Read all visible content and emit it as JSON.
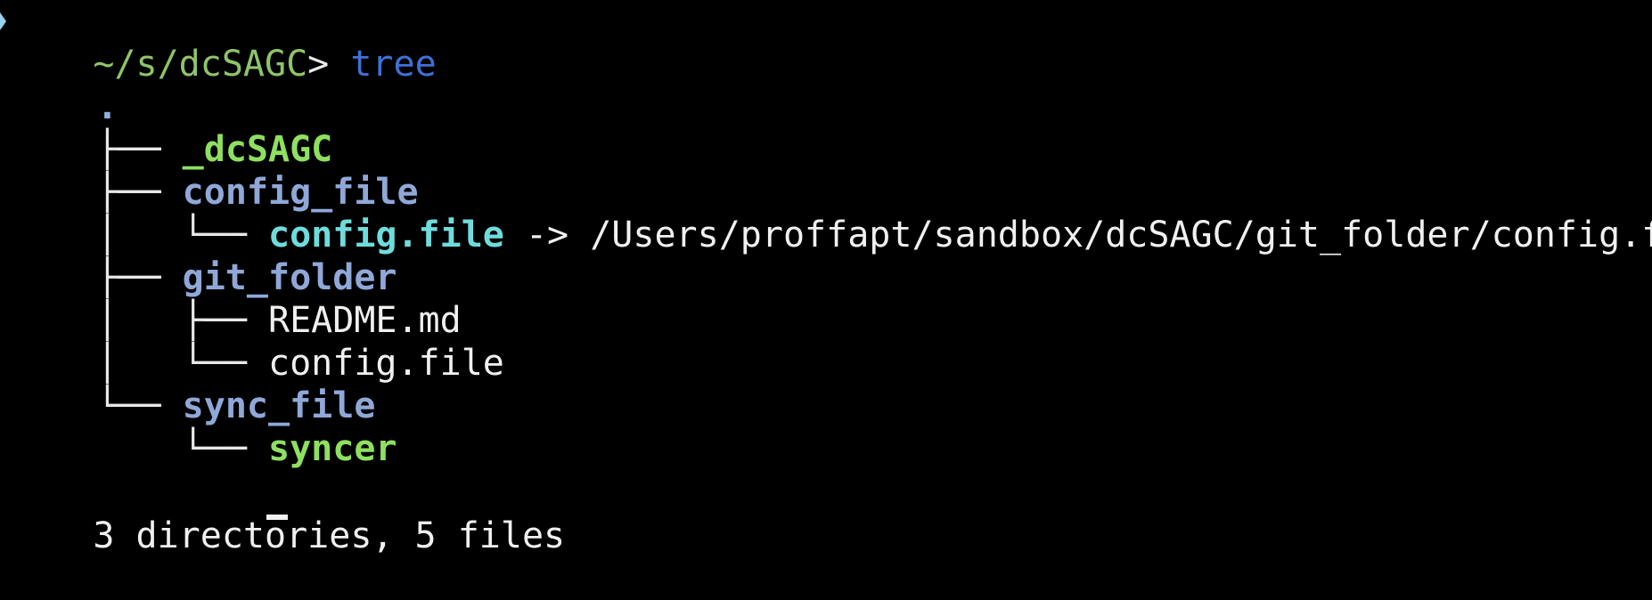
{
  "prompt": {
    "path": "~/s/dcSAGC",
    "symbol": ">",
    "command": "tree"
  },
  "tree": {
    "root": ".",
    "entries": [
      {
        "prefix": "├── ",
        "name": "_dcSAGC",
        "kind": "executable"
      },
      {
        "prefix": "├── ",
        "name": "config_file",
        "kind": "directory"
      },
      {
        "prefix": "│   └── ",
        "name": "config.file",
        "kind": "symlink",
        "target": " -> /Users/proffapt/sandbox/dcSAGC/git_folder/config.file"
      },
      {
        "prefix": "├── ",
        "name": "git_folder",
        "kind": "directory"
      },
      {
        "prefix": "│   ├── ",
        "name": "README.md",
        "kind": "file"
      },
      {
        "prefix": "│   └── ",
        "name": "config.file",
        "kind": "file"
      },
      {
        "prefix": "└── ",
        "name": "sync_file",
        "kind": "directory"
      },
      {
        "prefix": "    └── ",
        "name": "syncer",
        "kind": "executable"
      }
    ]
  },
  "summary": "3 directories, 5 files",
  "colors": {
    "background": "#000000",
    "path": "#8fc46a",
    "command": "#3f71d8",
    "directory": "#8fa8d8",
    "executable": "#8ee060",
    "symlink": "#6fdcdc",
    "text": "#f0f0f0"
  }
}
